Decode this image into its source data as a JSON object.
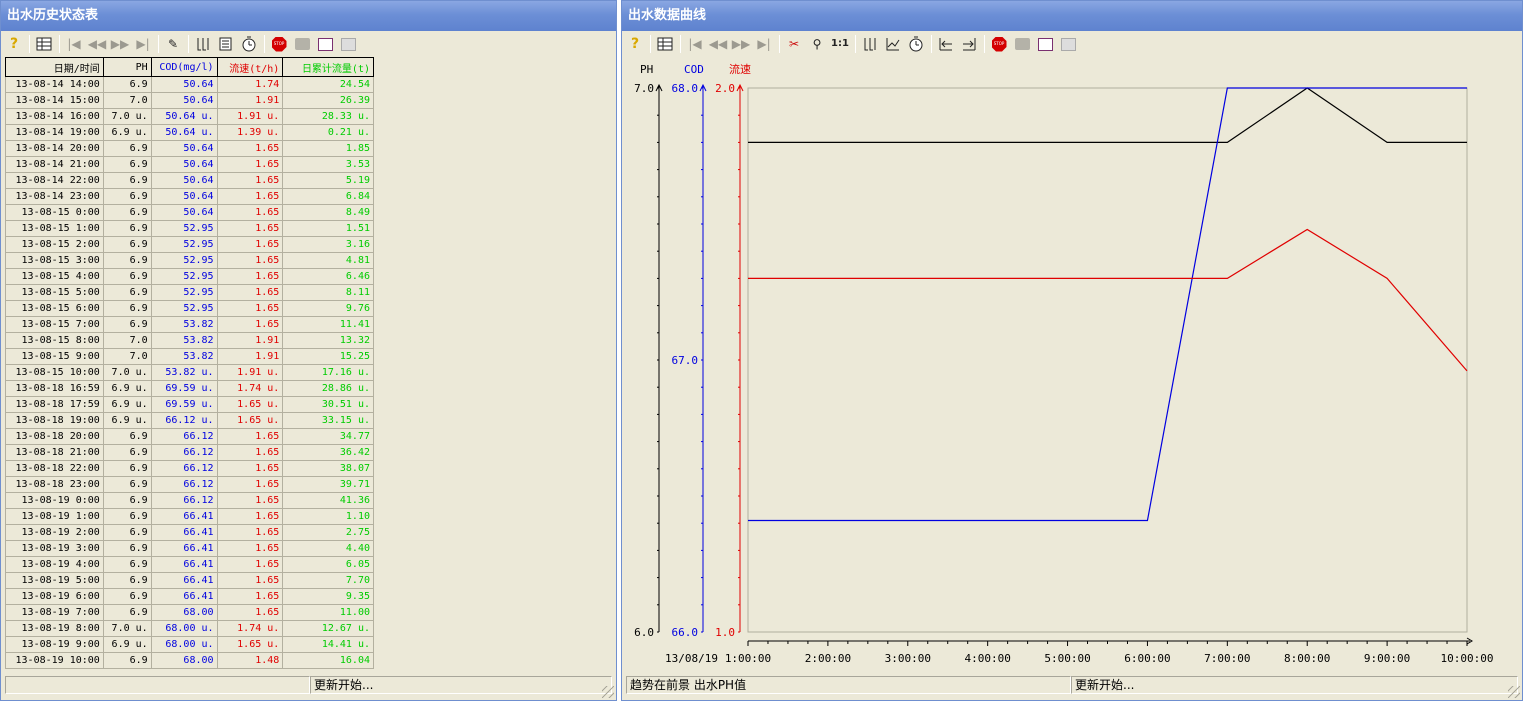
{
  "left_window": {
    "title": "出水历史状态表",
    "toolbar_icons": [
      "help-icon",
      "table-icon",
      "first-icon",
      "prev-icon",
      "next-icon",
      "last-icon",
      "edit-icon",
      "bars-icon",
      "book-icon",
      "clock-icon",
      "stop-icon",
      "print-icon",
      "chart-icon",
      "export-icon"
    ],
    "columns": [
      "日期/时间",
      "PH",
      "COD(mg/l)",
      "流速(t/h)",
      "日累计流量(t)"
    ],
    "rows": [
      [
        "13-08-14 14:00",
        "6.9",
        "50.64",
        "1.74",
        "24.54"
      ],
      [
        "13-08-14 15:00",
        "7.0",
        "50.64",
        "1.91",
        "26.39"
      ],
      [
        "13-08-14 16:00",
        "7.0 u.",
        "50.64 u.",
        "1.91 u.",
        "28.33 u."
      ],
      [
        "13-08-14 19:00",
        "6.9 u.",
        "50.64 u.",
        "1.39 u.",
        "0.21 u."
      ],
      [
        "13-08-14 20:00",
        "6.9",
        "50.64",
        "1.65",
        "1.85"
      ],
      [
        "13-08-14 21:00",
        "6.9",
        "50.64",
        "1.65",
        "3.53"
      ],
      [
        "13-08-14 22:00",
        "6.9",
        "50.64",
        "1.65",
        "5.19"
      ],
      [
        "13-08-14 23:00",
        "6.9",
        "50.64",
        "1.65",
        "6.84"
      ],
      [
        "13-08-15 0:00",
        "6.9",
        "50.64",
        "1.65",
        "8.49"
      ],
      [
        "13-08-15 1:00",
        "6.9",
        "52.95",
        "1.65",
        "1.51"
      ],
      [
        "13-08-15 2:00",
        "6.9",
        "52.95",
        "1.65",
        "3.16"
      ],
      [
        "13-08-15 3:00",
        "6.9",
        "52.95",
        "1.65",
        "4.81"
      ],
      [
        "13-08-15 4:00",
        "6.9",
        "52.95",
        "1.65",
        "6.46"
      ],
      [
        "13-08-15 5:00",
        "6.9",
        "52.95",
        "1.65",
        "8.11"
      ],
      [
        "13-08-15 6:00",
        "6.9",
        "52.95",
        "1.65",
        "9.76"
      ],
      [
        "13-08-15 7:00",
        "6.9",
        "53.82",
        "1.65",
        "11.41"
      ],
      [
        "13-08-15 8:00",
        "7.0",
        "53.82",
        "1.91",
        "13.32"
      ],
      [
        "13-08-15 9:00",
        "7.0",
        "53.82",
        "1.91",
        "15.25"
      ],
      [
        "13-08-15 10:00",
        "7.0 u.",
        "53.82 u.",
        "1.91 u.",
        "17.16 u."
      ],
      [
        "13-08-18 16:59",
        "6.9 u.",
        "69.59 u.",
        "1.74 u.",
        "28.86 u."
      ],
      [
        "13-08-18 17:59",
        "6.9 u.",
        "69.59 u.",
        "1.65 u.",
        "30.51 u."
      ],
      [
        "13-08-18 19:00",
        "6.9 u.",
        "66.12 u.",
        "1.65 u.",
        "33.15 u."
      ],
      [
        "13-08-18 20:00",
        "6.9",
        "66.12",
        "1.65",
        "34.77"
      ],
      [
        "13-08-18 21:00",
        "6.9",
        "66.12",
        "1.65",
        "36.42"
      ],
      [
        "13-08-18 22:00",
        "6.9",
        "66.12",
        "1.65",
        "38.07"
      ],
      [
        "13-08-18 23:00",
        "6.9",
        "66.12",
        "1.65",
        "39.71"
      ],
      [
        "13-08-19 0:00",
        "6.9",
        "66.12",
        "1.65",
        "41.36"
      ],
      [
        "13-08-19 1:00",
        "6.9",
        "66.41",
        "1.65",
        "1.10"
      ],
      [
        "13-08-19 2:00",
        "6.9",
        "66.41",
        "1.65",
        "2.75"
      ],
      [
        "13-08-19 3:00",
        "6.9",
        "66.41",
        "1.65",
        "4.40"
      ],
      [
        "13-08-19 4:00",
        "6.9",
        "66.41",
        "1.65",
        "6.05"
      ],
      [
        "13-08-19 5:00",
        "6.9",
        "66.41",
        "1.65",
        "7.70"
      ],
      [
        "13-08-19 6:00",
        "6.9",
        "66.41",
        "1.65",
        "9.35"
      ],
      [
        "13-08-19 7:00",
        "6.9",
        "68.00",
        "1.65",
        "11.00"
      ],
      [
        "13-08-19 8:00",
        "7.0 u.",
        "68.00 u.",
        "1.74 u.",
        "12.67 u."
      ],
      [
        "13-08-19 9:00",
        "6.9 u.",
        "68.00 u.",
        "1.65 u.",
        "14.41 u."
      ],
      [
        "13-08-19 10:00",
        "6.9",
        "68.00",
        "1.48",
        "16.04"
      ]
    ],
    "status": [
      "",
      "更新开始..."
    ]
  },
  "right_window": {
    "title": "出水数据曲线",
    "toolbar_icons": [
      "help-icon",
      "table-icon",
      "first-icon",
      "prev-icon",
      "next-icon",
      "last-icon",
      "filter-icon",
      "zoom-icon",
      "scale-1-1-icon",
      "bars-icon",
      "trend-icon",
      "clock-icon",
      "step-back-icon",
      "step-forward-icon",
      "stop-icon",
      "print-icon",
      "chart-icon",
      "export-icon"
    ],
    "zoom_label": "1:1",
    "status": [
      "趋势在前景 出水PH值",
      "更新开始..."
    ]
  },
  "colors": {
    "ph": "#000000",
    "cod": "#0000e0",
    "flow": "#e00000",
    "cumulative": "#00cc00"
  },
  "chart_data": {
    "type": "line",
    "x": [
      "1:00:00",
      "2:00:00",
      "3:00:00",
      "4:00:00",
      "5:00:00",
      "6:00:00",
      "7:00:00",
      "8:00:00",
      "9:00:00",
      "10:00:00"
    ],
    "date_label": "13/08/19",
    "axes": [
      {
        "name": "PH",
        "min": "6.0",
        "max": "7.0",
        "range": [
          6.0,
          7.0
        ],
        "color": "#000000"
      },
      {
        "name": "COD",
        "min": "66.0",
        "mid": "67.0",
        "max": "68.0",
        "range": [
          66.0,
          68.0
        ],
        "color": "#0000e0"
      },
      {
        "name": "流速",
        "min": "1.0",
        "max": "2.0",
        "range": [
          1.0,
          2.0
        ],
        "color": "#e00000"
      }
    ],
    "series": [
      {
        "name": "PH",
        "axis": 0,
        "values": [
          6.9,
          6.9,
          6.9,
          6.9,
          6.9,
          6.9,
          6.9,
          7.0,
          6.9,
          6.9
        ]
      },
      {
        "name": "COD",
        "axis": 1,
        "values": [
          66.41,
          66.41,
          66.41,
          66.41,
          66.41,
          66.41,
          68.0,
          68.0,
          68.0,
          68.0
        ]
      },
      {
        "name": "流速",
        "axis": 2,
        "values": [
          1.65,
          1.65,
          1.65,
          1.65,
          1.65,
          1.65,
          1.65,
          1.74,
          1.65,
          1.48
        ]
      }
    ],
    "grid": false
  }
}
